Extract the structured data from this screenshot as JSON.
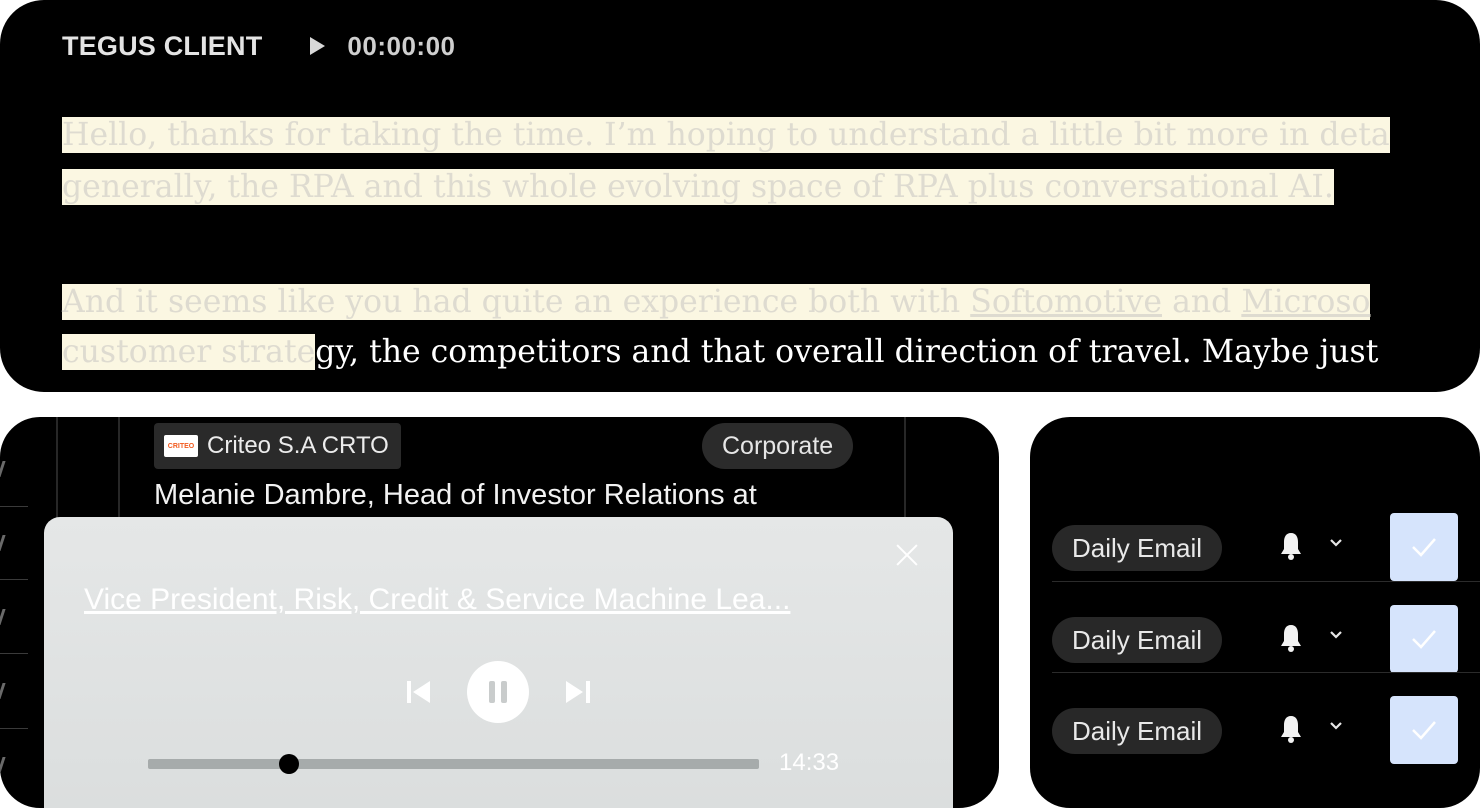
{
  "transcript": {
    "speaker": "TEGUS CLIENT",
    "timecode": "00:00:00",
    "lines": [
      {
        "highlighted": "Hello, thanks for taking the time. I’m hoping to understand a little bit more in deta",
        "rest": ""
      },
      {
        "highlighted": "generally, the RPA and this whole evolving space of RPA plus conversational AI.",
        "rest": ""
      },
      {
        "highlighted_a": "And it seems like you had quite an experience both with ",
        "underlined_a": "Softomotive",
        "highlighted_b": " and ",
        "underlined_b": "Microso"
      },
      {
        "highlighted": "customer strate",
        "rest": "gy, the competitors and that overall direction of travel. Maybe just"
      }
    ]
  },
  "call_card": {
    "company_logo_text": "CRITEO",
    "company": "Criteo S.A CRTO",
    "category": "Corporate",
    "expert": "Melanie Dambre, Head of Investor Relations at"
  },
  "player": {
    "title": "Vice President, Risk, Credit & Service Machine Lea...",
    "duration": "14:33",
    "progress": 0.23,
    "state": "playing"
  },
  "alerts": {
    "check_color": "#d6e4fc",
    "rows": [
      {
        "label": "Daily Email",
        "checked": true
      },
      {
        "label": "Daily Email",
        "checked": true
      },
      {
        "label": "Daily Email",
        "checked": true
      }
    ]
  }
}
